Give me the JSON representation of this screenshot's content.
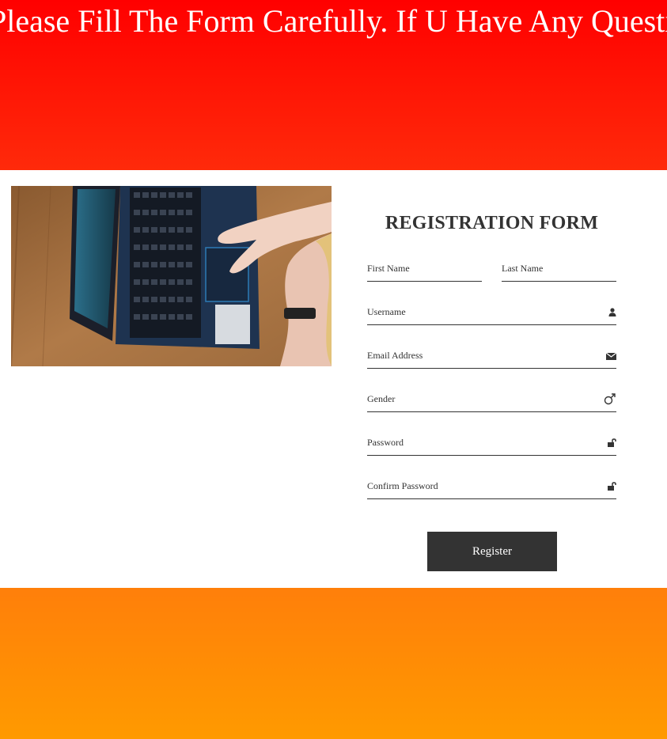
{
  "banner": {
    "marquee_text": "Please Fill The Form Carefully. If U Have Any Question To"
  },
  "form": {
    "title": "REGISTRATION FORM",
    "first_name_placeholder": "First Name",
    "last_name_placeholder": "Last Name",
    "username_placeholder": "Username",
    "email_placeholder": "Email Address",
    "gender_placeholder": "Gender",
    "password_placeholder": "Password",
    "confirm_password_placeholder": "Confirm Password",
    "register_label": "Register"
  },
  "icons": {
    "username": "user-icon",
    "email": "envelope-icon",
    "gender": "male-symbol-icon",
    "password": "unlock-icon",
    "confirm_password": "unlock-icon"
  },
  "colors": {
    "top_banner": "#ff0000",
    "bottom_banner": "#ff9a00",
    "button": "#333333",
    "text": "#333333"
  }
}
